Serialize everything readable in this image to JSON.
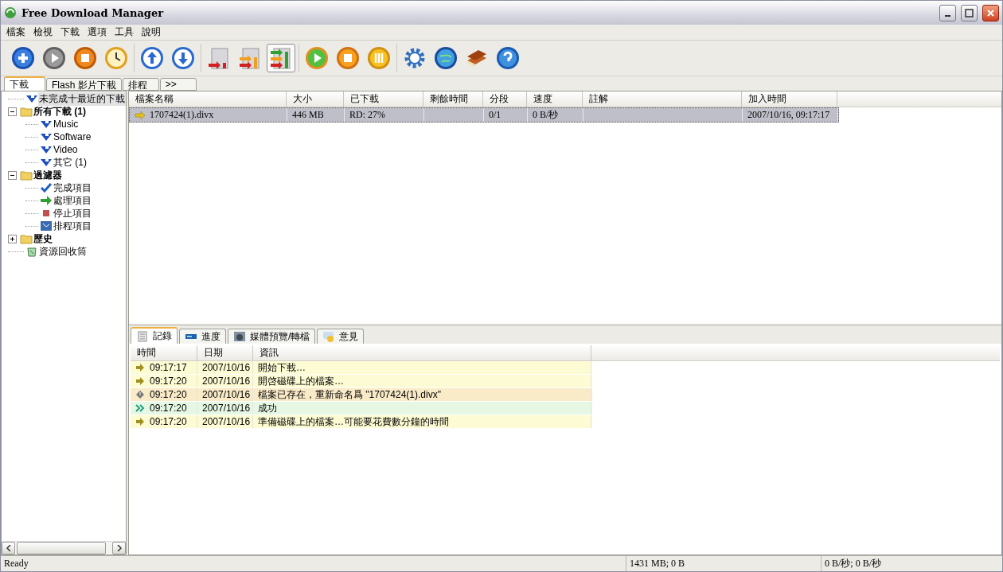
{
  "window": {
    "title": "Free Download Manager"
  },
  "menu": [
    "檔案",
    "檢視",
    "下載",
    "選項",
    "工具",
    "說明"
  ],
  "toolbar": [
    [
      {
        "kind": "add",
        "selected": false
      },
      {
        "kind": "start",
        "selected": false
      },
      {
        "kind": "stop",
        "selected": false
      },
      {
        "kind": "scheduler",
        "selected": false
      }
    ],
    [
      {
        "kind": "up",
        "selected": false
      },
      {
        "kind": "down",
        "selected": false
      }
    ],
    [
      {
        "kind": "mode-light",
        "selected": false
      },
      {
        "kind": "mode-medium",
        "selected": false
      },
      {
        "kind": "mode-heavy",
        "selected": true
      }
    ],
    [
      {
        "kind": "start-all",
        "selected": false
      },
      {
        "kind": "stop-all",
        "selected": false
      },
      {
        "kind": "pause-all",
        "selected": false
      }
    ],
    [
      {
        "kind": "settings",
        "selected": false
      },
      {
        "kind": "globe",
        "selected": false
      },
      {
        "kind": "book",
        "selected": false
      },
      {
        "kind": "help",
        "selected": false
      }
    ]
  ],
  "tabs": [
    {
      "label": "下載",
      "selected": true
    },
    {
      "label": "Flash 影片下載",
      "selected": false
    },
    {
      "label": "排程",
      "selected": false
    },
    {
      "label": ">>",
      "selected": false
    }
  ],
  "tree": [
    {
      "label": "未完成十最近的下載",
      "kind": "download",
      "selected": true
    },
    {
      "label": "所有下載 (1)",
      "kind": "folder",
      "expanded": true,
      "selected": false,
      "children": [
        {
          "label": "Music",
          "kind": "download",
          "selected": false
        },
        {
          "label": "Software",
          "kind": "download",
          "selected": false
        },
        {
          "label": "Video",
          "kind": "download",
          "selected": false
        },
        {
          "label": "其它 (1)",
          "kind": "download",
          "selected": false
        }
      ]
    },
    {
      "label": "過濾器",
      "kind": "folder",
      "expanded": true,
      "selected": false,
      "children": [
        {
          "label": "完成項目",
          "kind": "check",
          "selected": false
        },
        {
          "label": "處理項目",
          "kind": "arrow",
          "selected": false
        },
        {
          "label": "停止項目",
          "kind": "stopped",
          "selected": false
        },
        {
          "label": "排程項目",
          "kind": "schedule",
          "selected": false
        }
      ]
    },
    {
      "label": "歷史",
      "kind": "folder",
      "expanded": false,
      "selected": false
    },
    {
      "label": "資源回收筒",
      "kind": "recycle",
      "selected": false
    }
  ],
  "downloads": {
    "columns": [
      "檔案名稱",
      "大小",
      "已下載",
      "剩餘時間",
      "分段",
      "速度",
      "註解",
      "加入時間"
    ],
    "rows": [
      {
        "selected": true,
        "cells": [
          "1707424(1).divx",
          "446 MB",
          "RD: 27%",
          "",
          "0/1",
          "0 B/秒",
          "",
          "2007/10/16, 09:17:17"
        ]
      }
    ]
  },
  "detail_tabs": [
    {
      "label": "記錄",
      "kind": "log",
      "selected": true
    },
    {
      "label": "進度",
      "kind": "progress",
      "selected": false
    },
    {
      "label": "媒體預覽/轉檔",
      "kind": "media",
      "selected": false
    },
    {
      "label": "意見",
      "kind": "opinion",
      "selected": false
    }
  ],
  "log": {
    "columns": [
      "時間",
      "日期",
      "資訊"
    ],
    "rows": [
      {
        "kind": "info",
        "time": "09:17:17",
        "date": "2007/10/16",
        "message": "開始下載…"
      },
      {
        "kind": "info",
        "time": "09:17:20",
        "date": "2007/10/16",
        "message": "開啓磁碟上的檔案…"
      },
      {
        "kind": "warning",
        "time": "09:17:20",
        "date": "2007/10/16",
        "message": "檔案已存在，重新命名爲 \"1707424(1).divx\""
      },
      {
        "kind": "success",
        "time": "09:17:20",
        "date": "2007/10/16",
        "message": "成功"
      },
      {
        "kind": "info",
        "time": "09:17:20",
        "date": "2007/10/16",
        "message": "準備磁碟上的檔案…可能要花費數分鐘的時間"
      }
    ]
  },
  "status_bar": [
    "Ready",
    "1431 MB; 0 B",
    "0 B/秒; 0 B/秒"
  ]
}
